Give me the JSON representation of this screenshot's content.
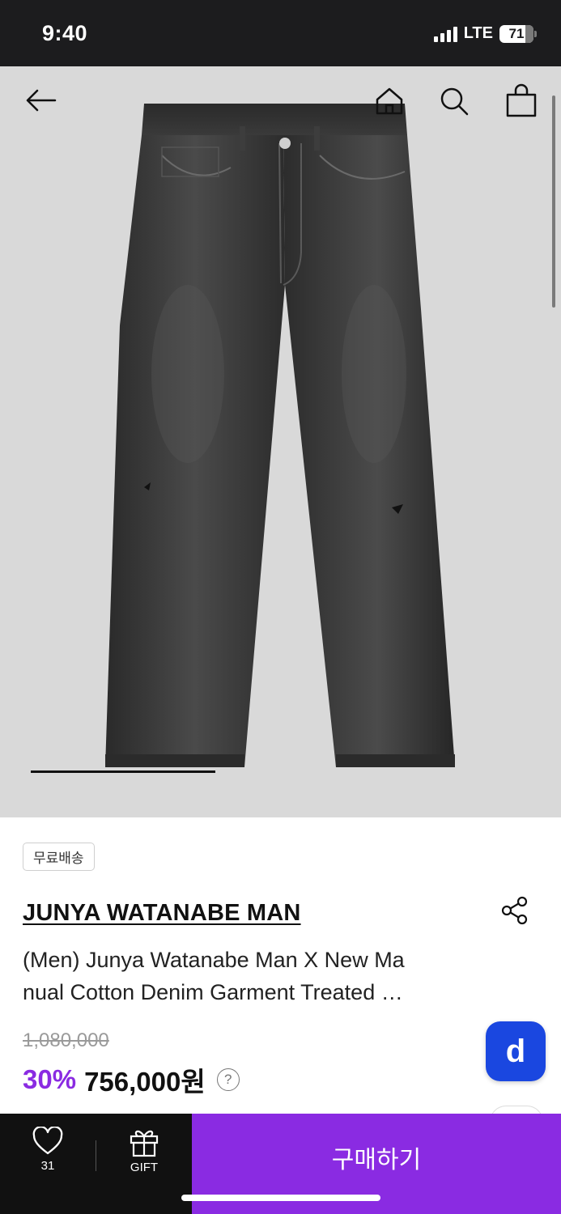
{
  "status_bar": {
    "time": "9:40",
    "network": "LTE",
    "battery": "71"
  },
  "header": {
    "back_icon": "arrow-left-icon",
    "home_icon": "home-icon",
    "search_icon": "search-icon",
    "cart_icon": "shopping-bag-icon"
  },
  "gallery": {
    "image_alt": "product-photo-black-denim-jeans",
    "progress_fraction": 0.37
  },
  "product": {
    "badge": "무료배송",
    "brand": "JUNYA WATANABE MAN",
    "title": "(Men) Junya Watanabe Man X New Manual Cotton Denim Garment Treated …",
    "title_line1": "(Men) Junya Watanabe Man X New Ma",
    "title_line2": "nual Cotton Denim Garment Treated …",
    "original_price": "1,080,000",
    "discount": "30%",
    "price": "756,000원",
    "help": "?",
    "share_icon": "share-icon",
    "floating_button": "d"
  },
  "bottom_bar": {
    "like_count": "31",
    "gift_label": "GIFT",
    "buy_label": "구매하기"
  },
  "colors": {
    "accent": "#8a2be2",
    "floating_button": "#1a47e0",
    "bar": "#111111"
  }
}
